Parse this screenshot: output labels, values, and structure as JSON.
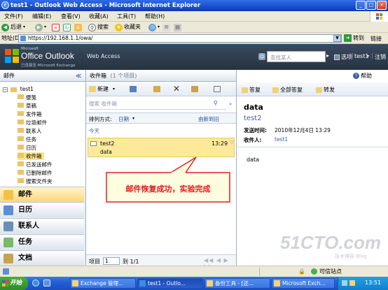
{
  "window": {
    "title": "test1 - Outlook Web Access - Microsoft Internet Explorer",
    "min": "_",
    "max": "□",
    "close": "×"
  },
  "menu": [
    "文件(F)",
    "编辑(E)",
    "查看(V)",
    "收藏(A)",
    "工具(T)",
    "帮助(H)"
  ],
  "ietoolbar": {
    "back": "后退",
    "search": "搜索",
    "favorites": "收藏夹"
  },
  "address": {
    "label": "地址(D)",
    "url": "https://192.168.1.1/owa/",
    "go": "转到",
    "links": "链接"
  },
  "owa": {
    "brand_small": "Microsoft",
    "brand": "Office Outlook",
    "brand_suffix": "Web Access",
    "brand_sub": "已连接至 Microsoft Exchange",
    "search_placeholder": "查找某人",
    "options": "选项",
    "user": "test1",
    "logout": "注销"
  },
  "nav": {
    "header": "邮件",
    "collapse": "≪",
    "root": "test1",
    "folders": [
      "便笺",
      "草稿",
      "发件箱",
      "垃圾邮件",
      "联系人",
      "任务",
      "日历",
      "收件箱",
      "已发送邮件",
      "已删除邮件",
      "搜索文件夹"
    ],
    "selected_folder": "收件箱",
    "buttons": [
      "邮件",
      "日历",
      "联系人",
      "任务",
      "文档"
    ]
  },
  "list": {
    "header": "收件箱",
    "count": "(1 个项目)",
    "new": "新建",
    "search_placeholder": "搜索 收件箱",
    "sort_label": "排列方式:",
    "sort_value": "日期",
    "order": "由新到旧",
    "group": "今天",
    "item": {
      "sender": "test2",
      "time": "13:29",
      "subject": "data"
    },
    "footer_label": "项目",
    "footer_page": "1",
    "footer_total": "到 1/1"
  },
  "annotation": {
    "text": "邮件恢复成功，实验完成",
    "color": "#e8171b"
  },
  "reading": {
    "reply": "答复",
    "reply_all": "全部答复",
    "forward": "转发",
    "help": "帮助",
    "subject": "data",
    "sender": "test2",
    "sent_label": "发送时间:",
    "sent_value": "2010年12月4日 13:29",
    "to_label": "收件人:",
    "to_value": "test1",
    "body": "data"
  },
  "statusbar": {
    "zone": "可信站点"
  },
  "taskbar": {
    "start": "开始",
    "items": [
      "Exchange 管理...",
      "test1 - Outlo...",
      "备份工具 - [还...",
      "Microsoft Exch..."
    ],
    "active_index": 1,
    "clock": "13:51"
  },
  "watermark": {
    "text": "51CTO.com",
    "sub": "技术博客 Blog"
  }
}
